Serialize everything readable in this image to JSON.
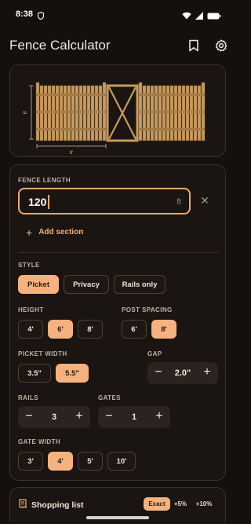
{
  "status": {
    "time": "8:38"
  },
  "app": {
    "title": "Fence Calculator"
  },
  "preview": {
    "height_label": "6'",
    "width_label": "8'"
  },
  "fence_length": {
    "label": "FENCE LENGTH",
    "value": "120",
    "unit": "ft"
  },
  "add_section": {
    "label": "Add section"
  },
  "style": {
    "label": "STYLE",
    "options": [
      "Picket",
      "Privacy",
      "Rails only"
    ],
    "selected": "Picket"
  },
  "height": {
    "label": "HEIGHT",
    "options": [
      "4'",
      "6'",
      "8'"
    ],
    "selected": "6'"
  },
  "post_spacing": {
    "label": "POST SPACING",
    "options": [
      "6'",
      "8'"
    ],
    "selected": "8'"
  },
  "picket_width": {
    "label": "PICKET WIDTH",
    "options": [
      "3.5\"",
      "5.5\""
    ],
    "selected": "5.5\""
  },
  "gap": {
    "label": "GAP",
    "value": "2.0\"",
    "minus": "−",
    "plus": "+"
  },
  "rails": {
    "label": "RAILS",
    "value": "3",
    "minus": "−",
    "plus": "+"
  },
  "gates": {
    "label": "GATES",
    "value": "1",
    "minus": "−",
    "plus": "+"
  },
  "gate_width": {
    "label": "GATE WIDTH",
    "options": [
      "3'",
      "4'",
      "5'",
      "10'"
    ],
    "selected": "4'"
  },
  "shopping": {
    "title": "Shopping list",
    "waste_options": [
      "Exact",
      "+5%",
      "+10%"
    ],
    "selected": "Exact"
  },
  "colors": {
    "accent": "#f6b27e",
    "background": "#14100d",
    "card": "#1a1512",
    "wood": "#c79a5e"
  }
}
